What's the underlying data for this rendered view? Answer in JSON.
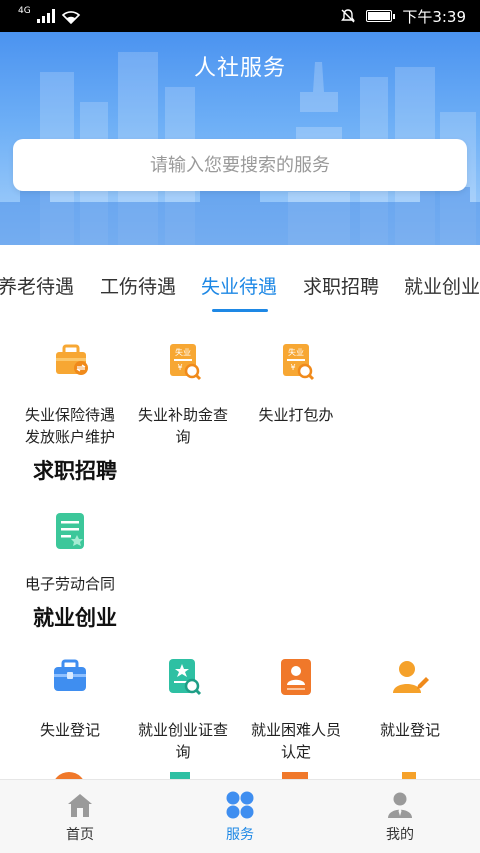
{
  "status_bar": {
    "network": "4G",
    "time": "下午3:39"
  },
  "header": {
    "title": "人社服务"
  },
  "search": {
    "placeholder": "请输入您要搜索的服务"
  },
  "tabs": [
    {
      "label": "养老待遇"
    },
    {
      "label": "工伤待遇"
    },
    {
      "label": "失业待遇"
    },
    {
      "label": "求职招聘"
    },
    {
      "label": "就业创业"
    }
  ],
  "active_tab": "失业待遇",
  "sections": {
    "unemployment": {
      "items": [
        {
          "label_line1": "失业保险待遇",
          "label_line2": "发放账户维护",
          "icon": "briefcase-transfer-icon"
        },
        {
          "label_line1": "失业补助金查",
          "label_line2": "询",
          "icon": "unemployment-search-icon",
          "badge": "失业"
        },
        {
          "label_line1": "失业打包办",
          "label_line2": "",
          "icon": "unemployment-package-icon",
          "badge": "失业"
        }
      ]
    },
    "job_recruit": {
      "title": "求职招聘",
      "items": [
        {
          "label_line1": "电子劳动合同",
          "label_line2": "",
          "icon": "contract-document-icon"
        }
      ]
    },
    "employment": {
      "title": "就业创业",
      "items": [
        {
          "label_line1": "失业登记",
          "label_line2": "",
          "icon": "briefcase-icon"
        },
        {
          "label_line1": "就业创业证查",
          "label_line2": "询",
          "icon": "certificate-search-icon"
        },
        {
          "label_line1": "就业困难人员",
          "label_line2": "认定",
          "icon": "id-card-person-icon"
        },
        {
          "label_line1": "就业登记",
          "label_line2": "",
          "icon": "person-edit-icon"
        }
      ]
    }
  },
  "bottom_nav": [
    {
      "label": "首页",
      "icon": "home-icon"
    },
    {
      "label": "服务",
      "icon": "services-grid-icon"
    },
    {
      "label": "我的",
      "icon": "user-profile-icon"
    }
  ],
  "colors": {
    "accent": "#1e88e5",
    "orange": "#f59a23",
    "green": "#3cc79a",
    "blue": "#3f8ef0"
  }
}
